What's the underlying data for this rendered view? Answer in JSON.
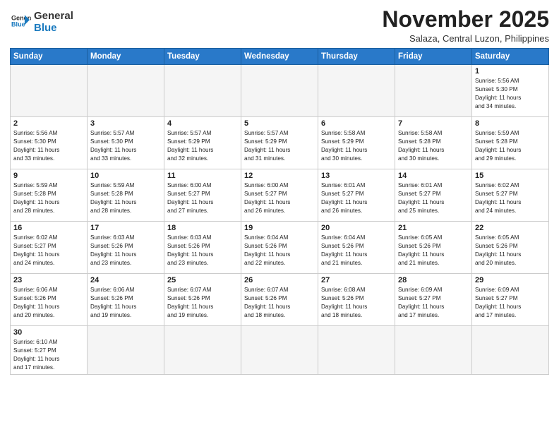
{
  "header": {
    "logo_general": "General",
    "logo_blue": "Blue",
    "month_title": "November 2025",
    "location": "Salaza, Central Luzon, Philippines"
  },
  "weekdays": [
    "Sunday",
    "Monday",
    "Tuesday",
    "Wednesday",
    "Thursday",
    "Friday",
    "Saturday"
  ],
  "weeks": [
    [
      {
        "day": "",
        "info": ""
      },
      {
        "day": "",
        "info": ""
      },
      {
        "day": "",
        "info": ""
      },
      {
        "day": "",
        "info": ""
      },
      {
        "day": "",
        "info": ""
      },
      {
        "day": "",
        "info": ""
      },
      {
        "day": "1",
        "info": "Sunrise: 5:56 AM\nSunset: 5:30 PM\nDaylight: 11 hours\nand 34 minutes."
      }
    ],
    [
      {
        "day": "2",
        "info": "Sunrise: 5:56 AM\nSunset: 5:30 PM\nDaylight: 11 hours\nand 33 minutes."
      },
      {
        "day": "3",
        "info": "Sunrise: 5:57 AM\nSunset: 5:30 PM\nDaylight: 11 hours\nand 33 minutes."
      },
      {
        "day": "4",
        "info": "Sunrise: 5:57 AM\nSunset: 5:29 PM\nDaylight: 11 hours\nand 32 minutes."
      },
      {
        "day": "5",
        "info": "Sunrise: 5:57 AM\nSunset: 5:29 PM\nDaylight: 11 hours\nand 31 minutes."
      },
      {
        "day": "6",
        "info": "Sunrise: 5:58 AM\nSunset: 5:29 PM\nDaylight: 11 hours\nand 30 minutes."
      },
      {
        "day": "7",
        "info": "Sunrise: 5:58 AM\nSunset: 5:28 PM\nDaylight: 11 hours\nand 30 minutes."
      },
      {
        "day": "8",
        "info": "Sunrise: 5:59 AM\nSunset: 5:28 PM\nDaylight: 11 hours\nand 29 minutes."
      }
    ],
    [
      {
        "day": "9",
        "info": "Sunrise: 5:59 AM\nSunset: 5:28 PM\nDaylight: 11 hours\nand 28 minutes."
      },
      {
        "day": "10",
        "info": "Sunrise: 5:59 AM\nSunset: 5:28 PM\nDaylight: 11 hours\nand 28 minutes."
      },
      {
        "day": "11",
        "info": "Sunrise: 6:00 AM\nSunset: 5:27 PM\nDaylight: 11 hours\nand 27 minutes."
      },
      {
        "day": "12",
        "info": "Sunrise: 6:00 AM\nSunset: 5:27 PM\nDaylight: 11 hours\nand 26 minutes."
      },
      {
        "day": "13",
        "info": "Sunrise: 6:01 AM\nSunset: 5:27 PM\nDaylight: 11 hours\nand 26 minutes."
      },
      {
        "day": "14",
        "info": "Sunrise: 6:01 AM\nSunset: 5:27 PM\nDaylight: 11 hours\nand 25 minutes."
      },
      {
        "day": "15",
        "info": "Sunrise: 6:02 AM\nSunset: 5:27 PM\nDaylight: 11 hours\nand 24 minutes."
      }
    ],
    [
      {
        "day": "16",
        "info": "Sunrise: 6:02 AM\nSunset: 5:27 PM\nDaylight: 11 hours\nand 24 minutes."
      },
      {
        "day": "17",
        "info": "Sunrise: 6:03 AM\nSunset: 5:26 PM\nDaylight: 11 hours\nand 23 minutes."
      },
      {
        "day": "18",
        "info": "Sunrise: 6:03 AM\nSunset: 5:26 PM\nDaylight: 11 hours\nand 23 minutes."
      },
      {
        "day": "19",
        "info": "Sunrise: 6:04 AM\nSunset: 5:26 PM\nDaylight: 11 hours\nand 22 minutes."
      },
      {
        "day": "20",
        "info": "Sunrise: 6:04 AM\nSunset: 5:26 PM\nDaylight: 11 hours\nand 21 minutes."
      },
      {
        "day": "21",
        "info": "Sunrise: 6:05 AM\nSunset: 5:26 PM\nDaylight: 11 hours\nand 21 minutes."
      },
      {
        "day": "22",
        "info": "Sunrise: 6:05 AM\nSunset: 5:26 PM\nDaylight: 11 hours\nand 20 minutes."
      }
    ],
    [
      {
        "day": "23",
        "info": "Sunrise: 6:06 AM\nSunset: 5:26 PM\nDaylight: 11 hours\nand 20 minutes."
      },
      {
        "day": "24",
        "info": "Sunrise: 6:06 AM\nSunset: 5:26 PM\nDaylight: 11 hours\nand 19 minutes."
      },
      {
        "day": "25",
        "info": "Sunrise: 6:07 AM\nSunset: 5:26 PM\nDaylight: 11 hours\nand 19 minutes."
      },
      {
        "day": "26",
        "info": "Sunrise: 6:07 AM\nSunset: 5:26 PM\nDaylight: 11 hours\nand 18 minutes."
      },
      {
        "day": "27",
        "info": "Sunrise: 6:08 AM\nSunset: 5:26 PM\nDaylight: 11 hours\nand 18 minutes."
      },
      {
        "day": "28",
        "info": "Sunrise: 6:09 AM\nSunset: 5:27 PM\nDaylight: 11 hours\nand 17 minutes."
      },
      {
        "day": "29",
        "info": "Sunrise: 6:09 AM\nSunset: 5:27 PM\nDaylight: 11 hours\nand 17 minutes."
      }
    ],
    [
      {
        "day": "30",
        "info": "Sunrise: 6:10 AM\nSunset: 5:27 PM\nDaylight: 11 hours\nand 17 minutes."
      },
      {
        "day": "",
        "info": ""
      },
      {
        "day": "",
        "info": ""
      },
      {
        "day": "",
        "info": ""
      },
      {
        "day": "",
        "info": ""
      },
      {
        "day": "",
        "info": ""
      },
      {
        "day": "",
        "info": ""
      }
    ]
  ]
}
